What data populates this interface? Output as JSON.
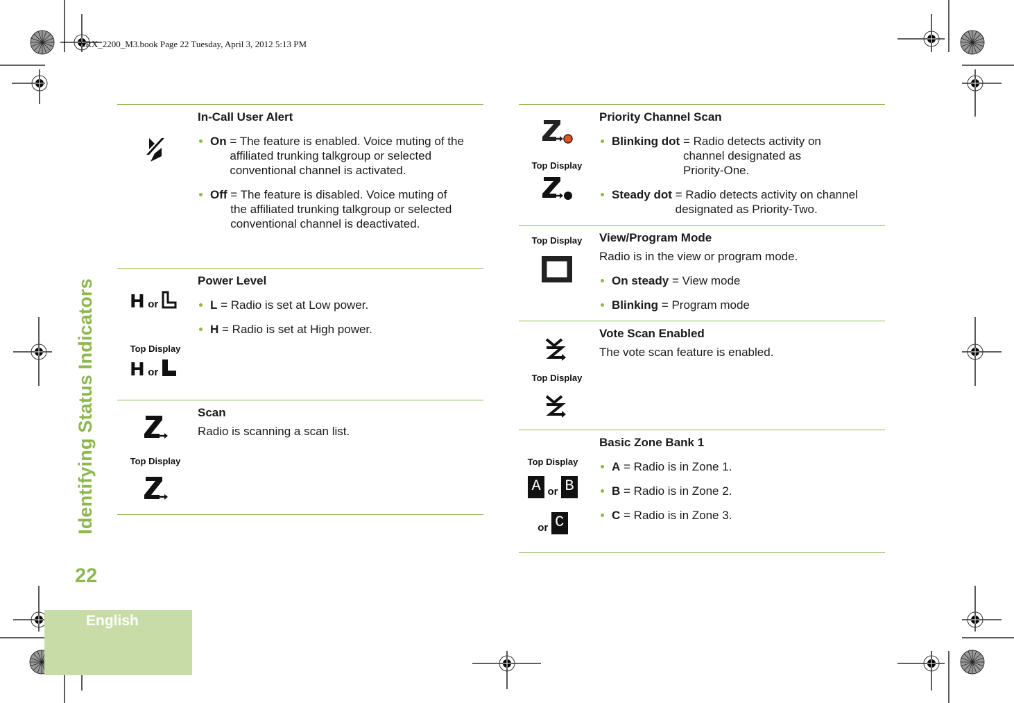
{
  "header": {
    "book_line": "SRX_2200_M3.book  Page 22  Tuesday, April 3, 2012  5:13 PM"
  },
  "sidebar": {
    "section_title": "Identifying Status Indicators",
    "page_number": "22",
    "language_tab": "English"
  },
  "colors": {
    "accent_green": "#8cb84e",
    "tab_green": "#c8dca8",
    "priority_dot_orange": "#e8501e"
  },
  "common": {
    "top_display": "Top Display",
    "or": "or"
  },
  "left_table": [
    {
      "icon": "in-call-user-alert-icon",
      "title": "In-Call User Alert",
      "bullets": [
        {
          "label": "On",
          "text": "= The feature is enabled. Voice muting of the affiliated trunking talkgroup or selected conventional channel is activated."
        },
        {
          "label": "Off",
          "text": "= The feature is disabled. Voice muting of the affiliated trunking talkgroup or selected conventional channel is deactivated."
        }
      ]
    },
    {
      "icon": "power-level-icon",
      "title": "Power Level",
      "icon_letters": [
        "H",
        "L"
      ],
      "bullets": [
        {
          "label": "L",
          "text": "= Radio is set at Low power."
        },
        {
          "label": "H",
          "text": "= Radio is set at High power."
        }
      ]
    },
    {
      "icon": "scan-icon",
      "title": "Scan",
      "description": "Radio is scanning a scan list."
    }
  ],
  "right_table": [
    {
      "icon": "priority-channel-scan-icon",
      "title": "Priority Channel Scan",
      "bullets": [
        {
          "label": "Blinking dot",
          "text": "= Radio detects activity on channel designated as Priority-One."
        },
        {
          "label": "Steady dot",
          "text": "= Radio detects activity on channel designated as Priority-Two."
        }
      ]
    },
    {
      "icon": "view-program-mode-icon",
      "title": "View/Program Mode",
      "description": "Radio is in the view or program mode.",
      "bullets": [
        {
          "label": "On steady",
          "text": "= View mode"
        },
        {
          "label": "Blinking",
          "text": "= Program mode"
        }
      ]
    },
    {
      "icon": "vote-scan-icon",
      "title": "Vote Scan Enabled",
      "description": "The vote scan feature is enabled."
    },
    {
      "icon": "zone-bank-icon",
      "title": "Basic Zone Bank 1",
      "icon_letters": [
        "A",
        "B",
        "C"
      ],
      "bullets": [
        {
          "label": "A",
          "text": "= Radio is in Zone 1."
        },
        {
          "label": "B",
          "text": "= Radio is in Zone 2."
        },
        {
          "label": "C",
          "text": "= Radio is in Zone 3."
        }
      ]
    }
  ]
}
